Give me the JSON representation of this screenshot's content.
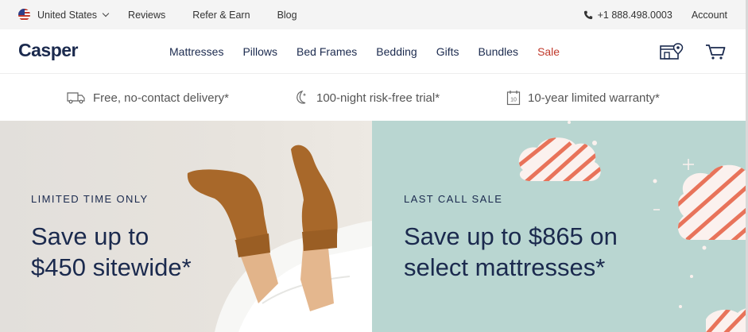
{
  "utility": {
    "country": "United States",
    "links": [
      "Reviews",
      "Refer & Earn",
      "Blog"
    ],
    "phone": "+1 888.498.0003",
    "account": "Account"
  },
  "nav": {
    "logo": "Casper",
    "menu": [
      "Mattresses",
      "Pillows",
      "Bed Frames",
      "Bedding",
      "Gifts",
      "Bundles",
      "Sale"
    ]
  },
  "benefits": [
    {
      "icon": "truck-icon",
      "label": "Free, no-contact delivery*"
    },
    {
      "icon": "moon-icon",
      "label": "100-night risk-free trial*"
    },
    {
      "icon": "calendar-icon",
      "label": "10-year limited warranty*"
    }
  ],
  "hero": {
    "left": {
      "eyebrow": "LIMITED TIME ONLY",
      "line1": "Save up to",
      "line2": "$450 sitewide*"
    },
    "right": {
      "eyebrow": "LAST CALL SALE",
      "line1": "Save up to $865 on",
      "line2": "select mattresses*"
    }
  },
  "colors": {
    "navy": "#1b2a4e",
    "sale_red": "#c0392b",
    "mint": "#b9d6d1",
    "coral": "#e8735a"
  }
}
